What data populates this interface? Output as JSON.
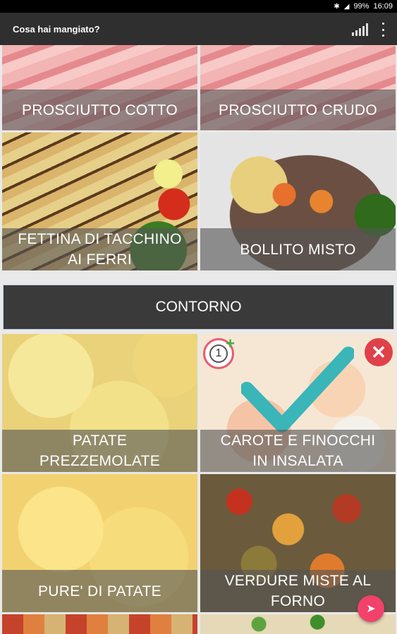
{
  "status_bar": {
    "icons": [
      "bluetooth-icon",
      "signal-icon"
    ],
    "battery": "99%",
    "time": "16:09"
  },
  "app_bar": {
    "title": "Cosa hai mangiato?",
    "actions": [
      "chart-icon",
      "more-vert-icon"
    ]
  },
  "tiles_top": [
    {
      "label": "PROSCIUTTO COTTO"
    },
    {
      "label": "PROSCIUTTO CRUDO"
    },
    {
      "label_lines": [
        "FETTINA DI TACCHINO",
        "AI FERRI"
      ]
    },
    {
      "label": "BOLLITO MISTO"
    }
  ],
  "section": {
    "title": "CONTORNO"
  },
  "tiles_contorno": [
    {
      "label_lines": [
        "PATATE",
        "PREZZEMOLATE"
      ]
    },
    {
      "label_lines": [
        "CAROTE E FINOCCHI",
        "IN INSALATA"
      ],
      "selected": true,
      "count": "1"
    },
    {
      "label": "PURE' DI PATATE"
    },
    {
      "label_lines": [
        "VERDURE MISTE AL",
        "FORNO"
      ]
    }
  ],
  "colors": {
    "app_bar": "#2f2f2f",
    "section_header": "#3a3a3a",
    "check": "#3ab5b8",
    "remove": "#e0404a",
    "fab": "#f2416b"
  },
  "fab_icon": "send-icon"
}
